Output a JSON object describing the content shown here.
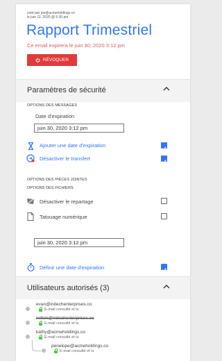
{
  "header": {
    "created_by": "créé par joe@acmeholdings.co",
    "created_on": "le juin 11, 2020 @ 5:30 pm",
    "title": "Rapport Trimestriel",
    "expiry_notice": "Ce email expirera le juin 30, 2020 3:12 pm",
    "revoke_label": "RÉVOQUER",
    "accent_color": "#2f76ff",
    "danger_color": "#e03a3a"
  },
  "security": {
    "title": "Paramètres de sécurité",
    "messages_caps": "OPTIONS DES MESSAGES",
    "expiration_label": "Date d'expiration",
    "expiration_value": "juin 30, 2020 3:12 pm",
    "add_expiration_label": "Ajouter une date d'expiration",
    "add_expiration_checked": true,
    "disable_forward_label": "Désactiver le transfert",
    "disable_forward_checked": true,
    "attachments_caps": "OPTIONS DES PIÈCES JOINTES",
    "files_caps": "OPTIONS DES FICHIERS",
    "disable_sharing_label": "Désactiver le repartage",
    "disable_sharing_checked": false,
    "watermark_label": "Tatouage numérique",
    "watermark_checked": false,
    "file_expiration_value": "juin 30, 2020 3:12 pm",
    "set_expiration_label": "Définir une date d'expiration",
    "set_expiration_checked": true
  },
  "users": {
    "title": "Utilisateurs autorisés (3)",
    "list": [
      {
        "email": "evan@initechenterprises.co",
        "status": "E-mail consulté et lu",
        "revoked": false
      },
      {
        "email": "milton@initechenterprises.co",
        "status": "E-mail consulté et lu",
        "revoked": true
      },
      {
        "email": "kathy@acmeholdings.co",
        "status": "E-mail consulté et lu",
        "revoked": false
      },
      {
        "email": "penelope@acmeholdings.co",
        "status": "E-mail consulté et lu",
        "revoked": false
      }
    ]
  }
}
